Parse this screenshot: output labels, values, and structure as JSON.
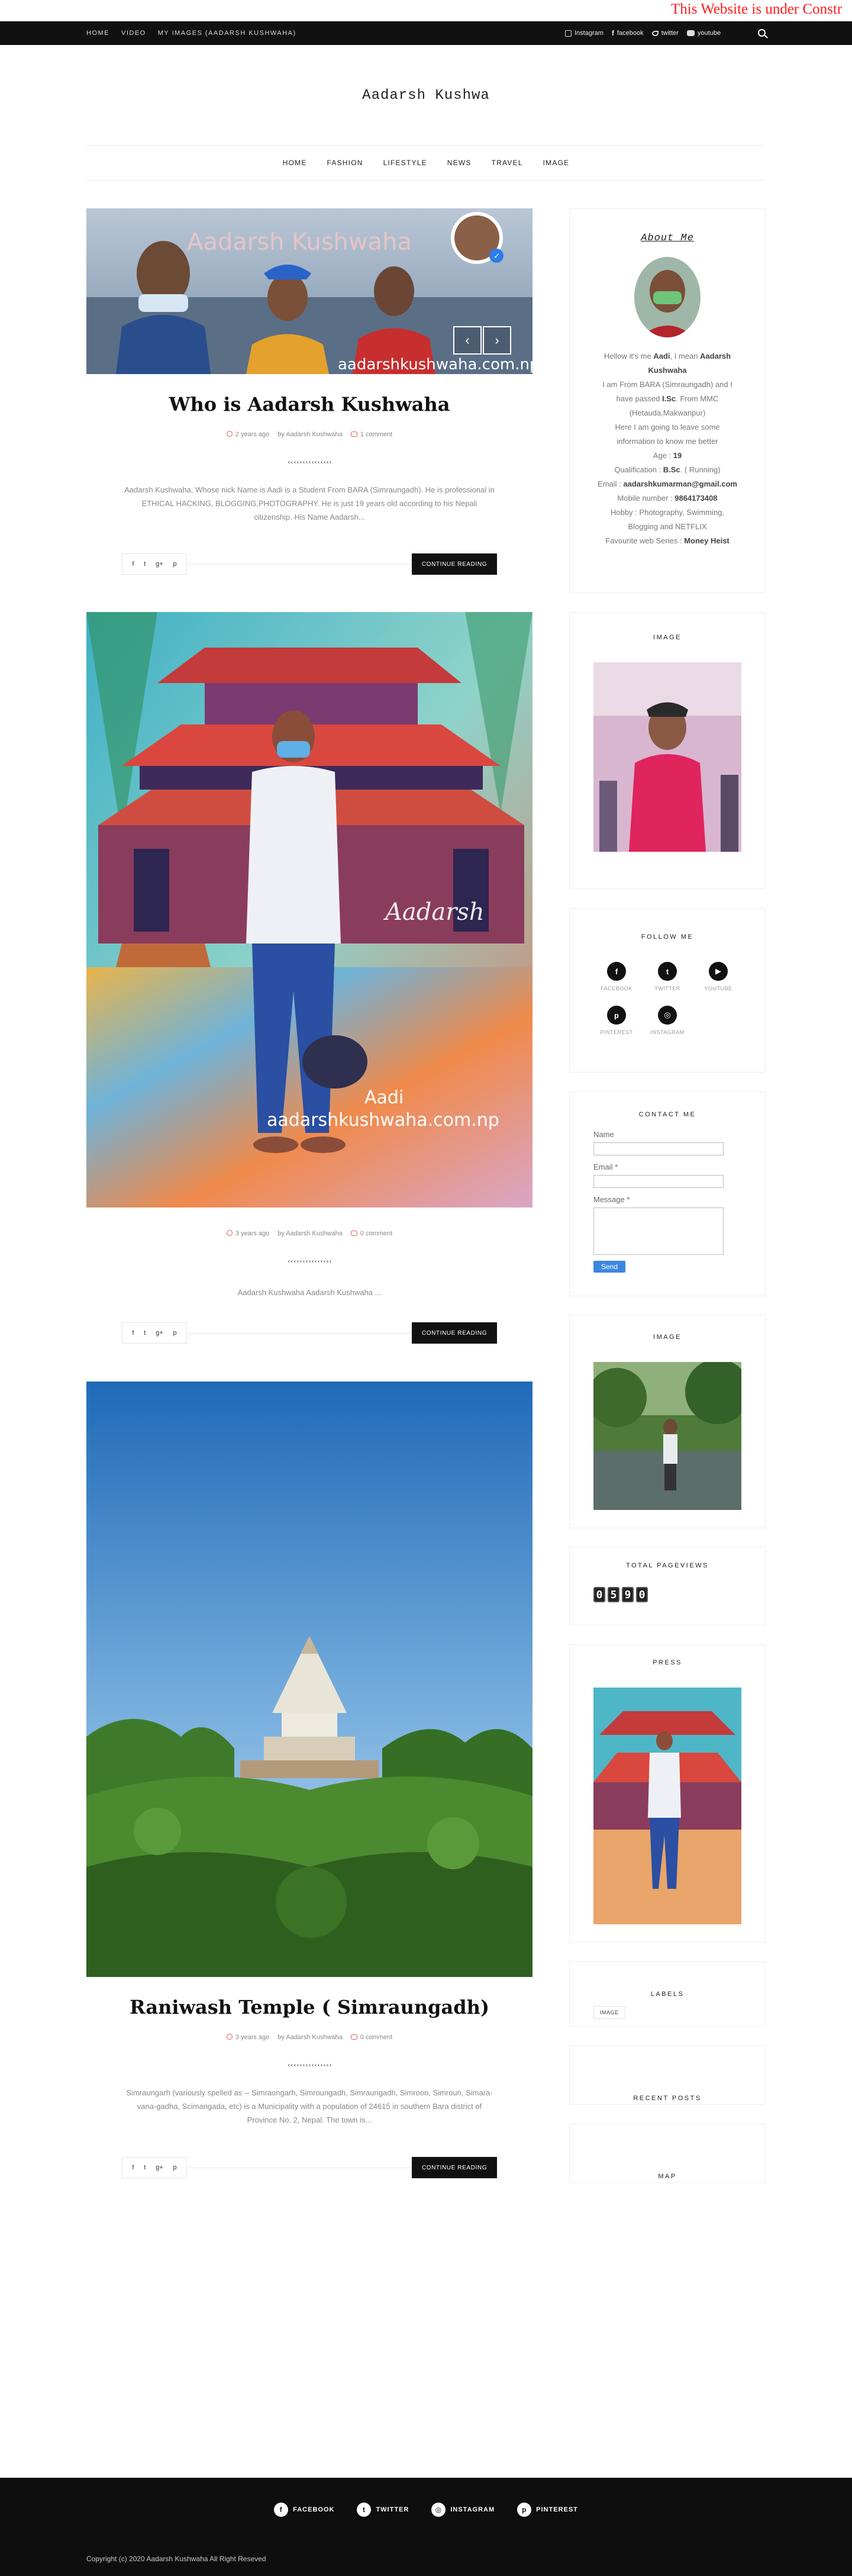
{
  "marquee": {
    "text": "This Website is under Constr"
  },
  "topbar": {
    "nav": [
      "HOME",
      "VIDEO",
      "MY IMAGES (AADARSH KUSHWAHA)"
    ],
    "social": [
      "Instagram",
      "facebook",
      "twitter",
      "youtube"
    ]
  },
  "site": {
    "title": "Aadarsh Kushwa"
  },
  "mainnav": [
    "HOME",
    "FASHION",
    "LIFESTYLE",
    "NEWS",
    "TRAVEL",
    "IMAGE"
  ],
  "slider": {
    "image_text": "Aadarsh Kushwaha",
    "watermark": "aadarshkushwaha.com.np",
    "prev": "‹",
    "next": "›"
  },
  "posts": [
    {
      "title": "Who is Aadarsh Kushwaha",
      "time": "2 years ago",
      "author_prefix": "by",
      "author": "Aadarsh Kushwaha",
      "comments": "1 comment",
      "squiggle": "‹‹‹‹‹‹‹‹‹‹‹‹‹‹‹",
      "excerpt": "Aadarsh Kushwaha, Whose nick Name is Aadi is a Student From BARA (Simraungadh). He is professional in ETHICAL HACKING, BLOGGING,PHOTOGRAPHY. He is just 19 years old according to his Nepali citizenship. His Name Aadarsh...",
      "read_more": "CONTINUE READING"
    },
    {
      "title": "",
      "image_script": "Aadarsh",
      "image_caption_1": "Aadi",
      "image_caption_2": "aadarshkushwaha.com.np",
      "time": "3 years ago",
      "author_prefix": "by",
      "author": "Aadarsh Kushwaha",
      "comments": "0 comment",
      "squiggle": "‹‹‹‹‹‹‹‹‹‹‹‹‹‹‹",
      "excerpt": "Aadarsh Kushwaha Aadarsh Kushwaha ...",
      "read_more": "CONTINUE READING"
    },
    {
      "title": "Raniwash Temple ( Simraungadh)",
      "time": "3 years ago",
      "author_prefix": "by",
      "author": "Aadarsh Kushwaha",
      "comments": "0 comment",
      "squiggle": "‹‹‹‹‹‹‹‹‹‹‹‹‹‹‹",
      "excerpt": "Simraungarh (variously spelled as -- Simraongarh, Simroungadh, Simraungadh, Simroon, Simroun, Simara-vana-gadha, Scimangada, etc) is a Municipality with a population of 24615 in southern Bara district of Province No. 2, Nepal. The town is...",
      "read_more": "CONTINUE READING"
    }
  ],
  "share_icons": [
    "f",
    "t",
    "g+",
    "p"
  ],
  "sidebar": {
    "about": {
      "title": "About Me",
      "l1a": "Hellow it's me ",
      "l1b": "Aadi",
      "l1c": ", I mean ",
      "l1d": "Aadarsh",
      "l2": "Kushwaha",
      "l3": "I am From BARA (Simraungadh) and I",
      "l4a": "have passed ",
      "l4b": "I.Sc",
      "l4c": ". From MMC",
      "l5": "(Hetauda,Makwanpur)",
      "l6": "Here I am going to leave some",
      "l7": "information to know me better",
      "l8a": "Age : ",
      "l8b": "19",
      "l9a": "Qualification : ",
      "l9b": "B.Sc",
      "l9c": ". ( Running)",
      "l10a": "Email : ",
      "l10b": "aadarshkumarman@gmail.com",
      "l11a": "Mobile number : ",
      "l11b": "9864173408",
      "l12": "Hobby : Photography, Swimming,",
      "l13": "Blogging and NETFLIX",
      "l14a": "Favourite web Series : ",
      "l14b": "Money Heist"
    },
    "image1": {
      "title": "IMAGE"
    },
    "follow": {
      "title": "FOLLOW ME",
      "items": [
        {
          "glyph": "f",
          "label": "FACEBOOK"
        },
        {
          "glyph": "t",
          "label": "TWITTER"
        },
        {
          "glyph": "▶",
          "label": "YOUTUBE"
        },
        {
          "glyph": "p",
          "label": "PINTEREST"
        },
        {
          "glyph": "◎",
          "label": "INSTAGRAM"
        }
      ]
    },
    "contact": {
      "title": "CONTACT ME",
      "name_label": "Name",
      "email_label": "Email *",
      "message_label": "Message *",
      "send": "Send"
    },
    "image2": {
      "title": "IMAGE"
    },
    "pageviews": {
      "title": "TOTAL PAGEVIEWS",
      "digits": [
        "0",
        "5",
        "9",
        "0"
      ]
    },
    "press": {
      "title": "PRESS"
    },
    "labels": {
      "title": "LABELS",
      "items": [
        "IMAGE"
      ]
    },
    "recent": {
      "title": "RECENT POSTS"
    },
    "map": {
      "title": "MAP"
    }
  },
  "footer": {
    "social": [
      {
        "glyph": "f",
        "label": "FACEBOOK"
      },
      {
        "glyph": "t",
        "label": "TWITTER"
      },
      {
        "glyph": "◎",
        "label": "INSTAGRAM"
      },
      {
        "glyph": "p",
        "label": "PINTEREST"
      }
    ],
    "copyright": "Copyright (c) 2020 Aadarsh Kushwaha All Right Reseved"
  }
}
